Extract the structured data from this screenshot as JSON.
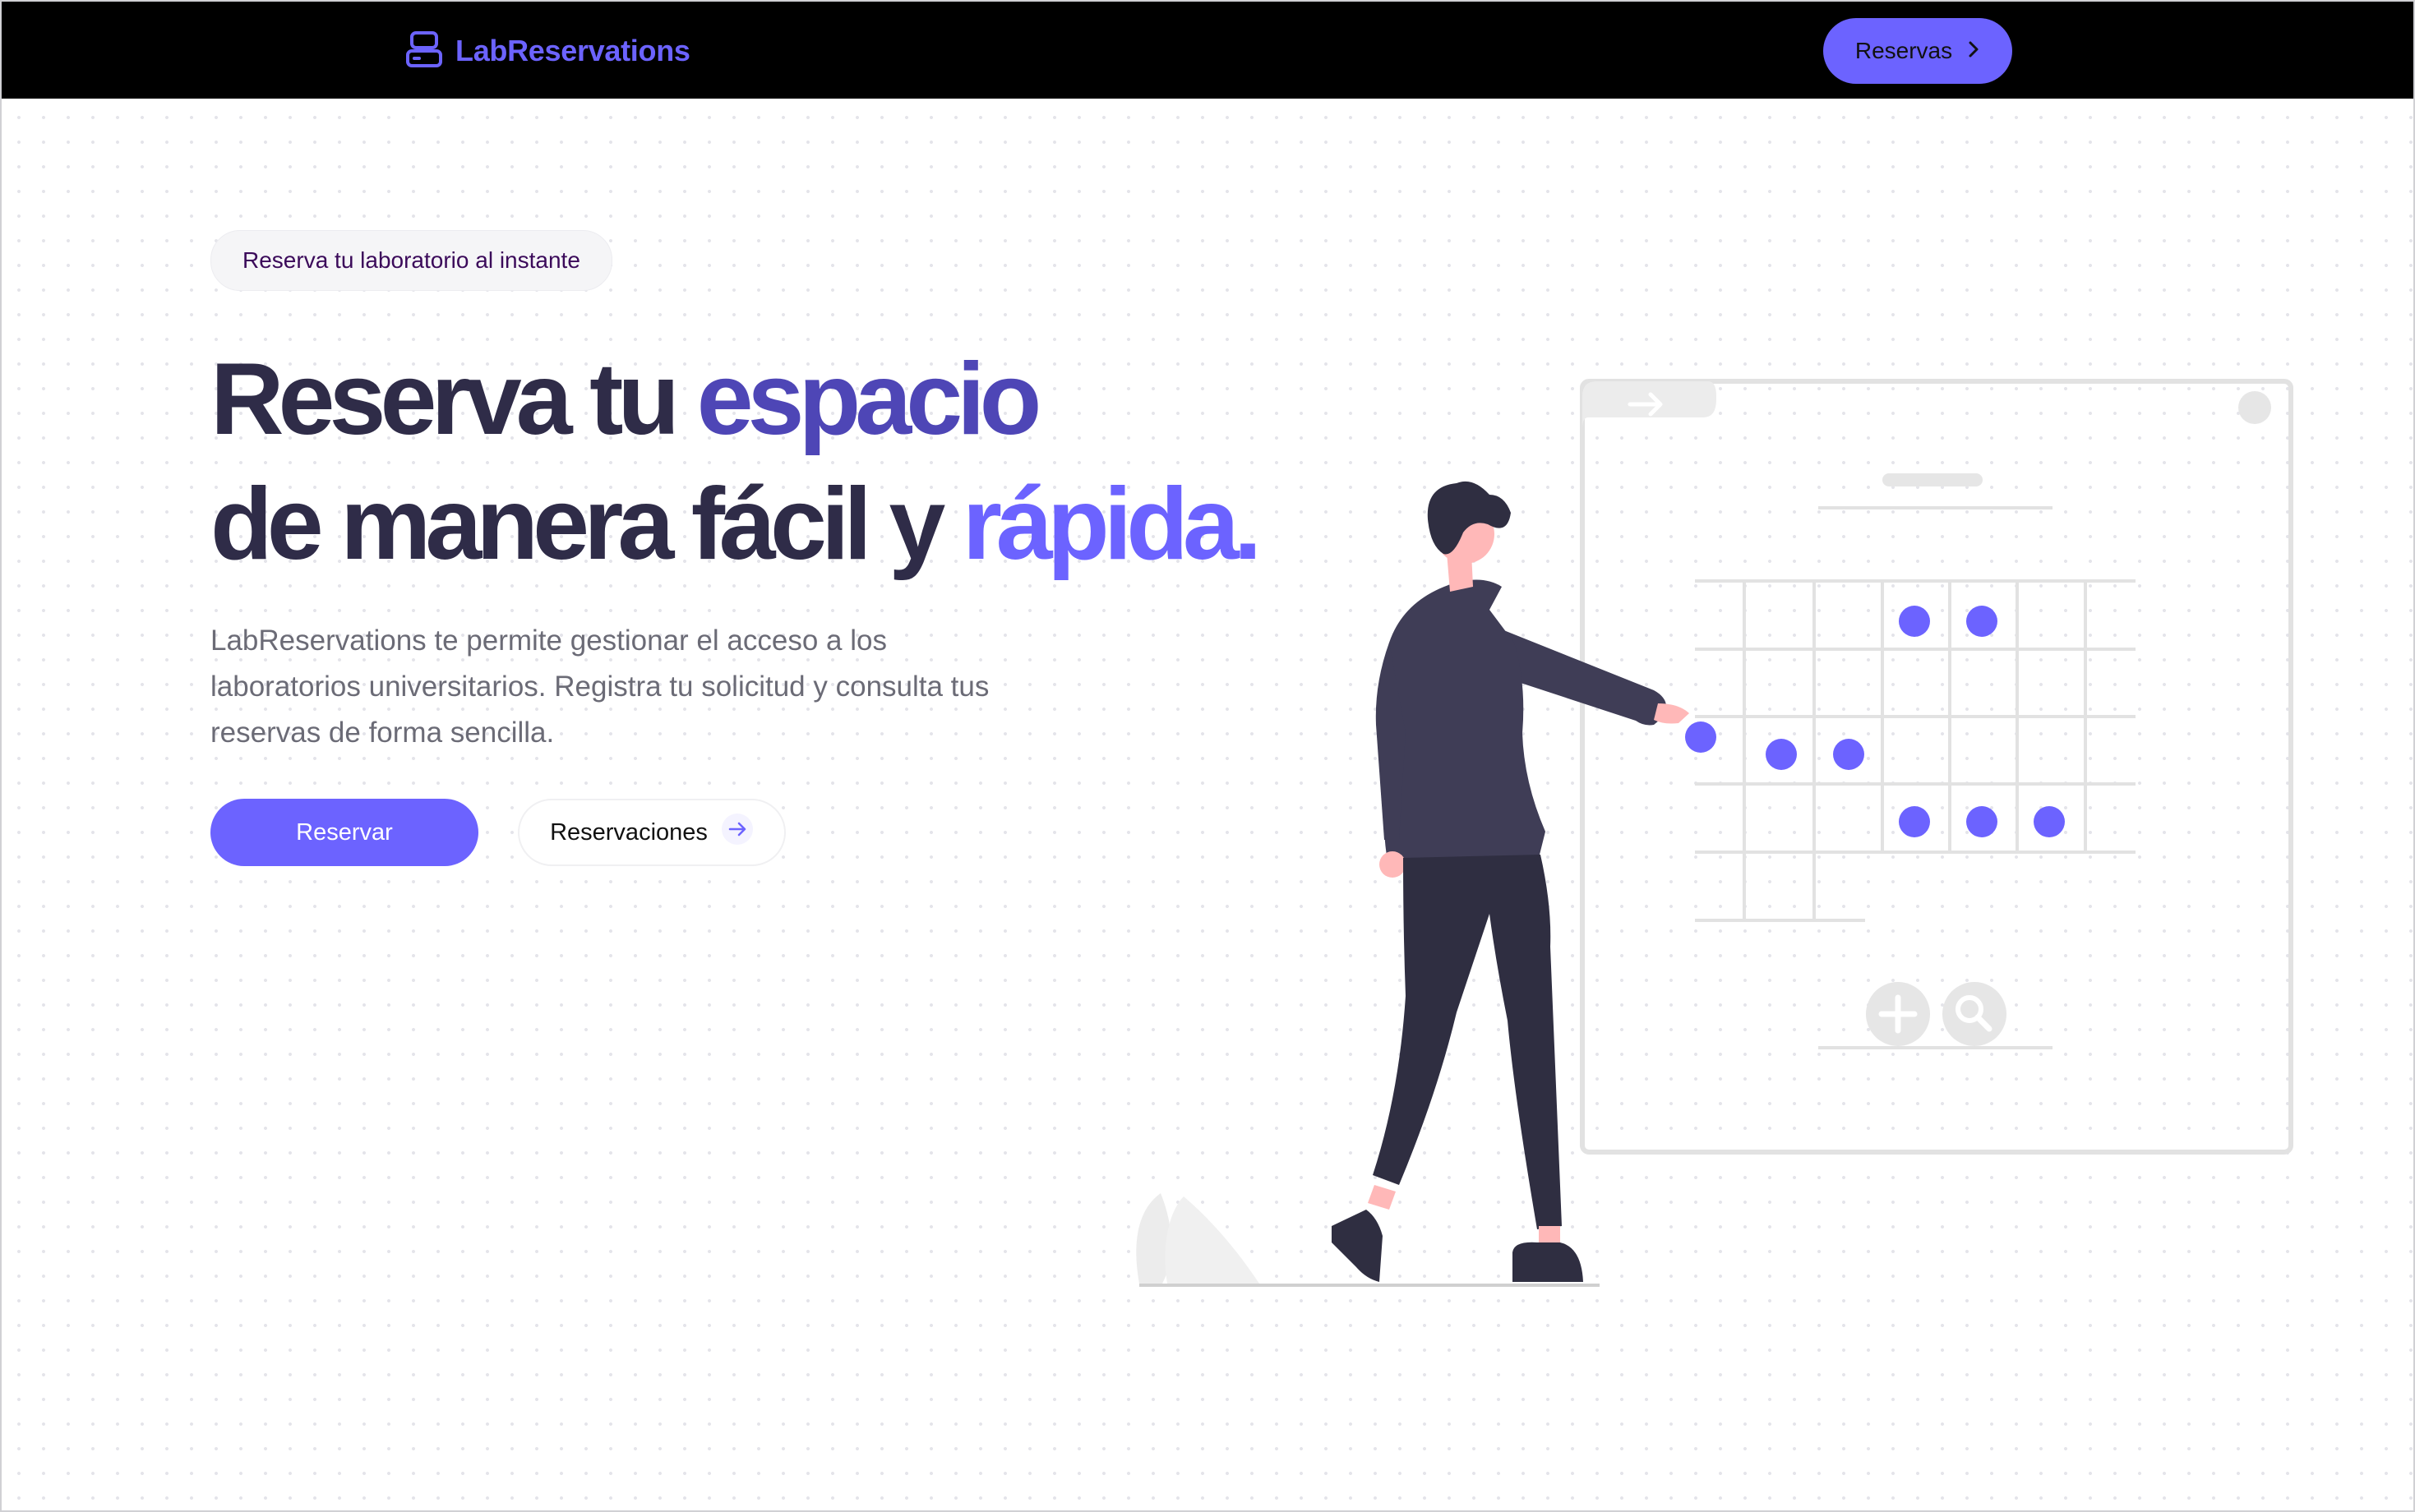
{
  "header": {
    "brand": "LabReservations",
    "nav_button_label": "Reservas"
  },
  "hero": {
    "badge": "Reserva tu laboratorio al instante",
    "title": {
      "line1_part1": "Reserva tu ",
      "line1_accent": "espacio",
      "line2_part1": "de manera fácil y ",
      "line2_accent": "rápida."
    },
    "description": "LabReservations te permite gestionar el acceso a los laboratorios universitarios. Registra tu solicitud y consulta tus reservas de forma sencilla.",
    "primary_button": "Reservar",
    "secondary_button": "Reservaciones"
  },
  "colors": {
    "accent": "#6c63ff",
    "accent_dark": "#4e46b6",
    "heading": "#2f2c48",
    "navbar": "#000000"
  },
  "icons": [
    "lab-logo-icon",
    "chevron-right-icon",
    "arrow-right-icon",
    "calendar-illustration"
  ]
}
